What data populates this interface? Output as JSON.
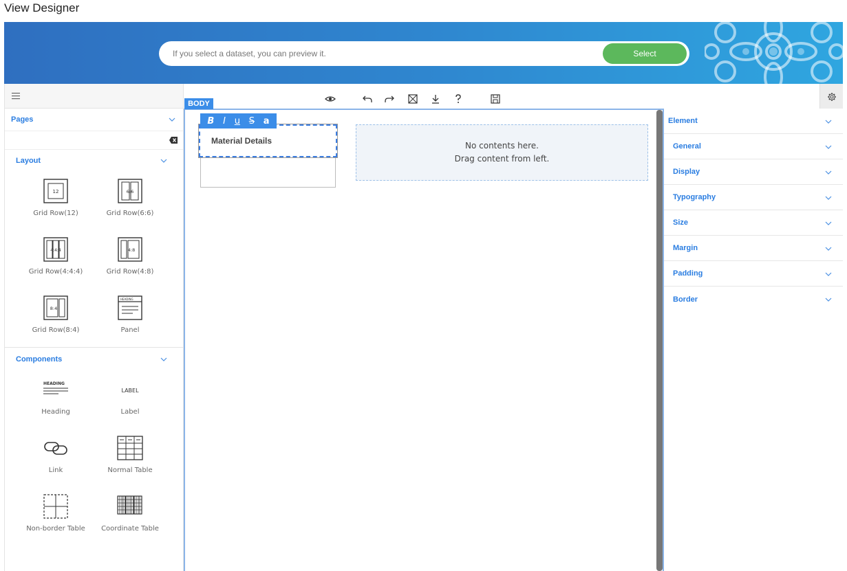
{
  "app": {
    "title": "View Designer"
  },
  "banner": {
    "search_placeholder": "If you select a dataset, you can preview it.",
    "select_label": "Select",
    "select_color": "#5cb85c"
  },
  "left_panel": {
    "pages_label": "Pages",
    "layout_label": "Layout",
    "layout_items": [
      {
        "label": "Grid Row(12)",
        "icon": "grid-row-12-icon"
      },
      {
        "label": "Grid Row(6:6)",
        "icon": "grid-row-6-6-icon"
      },
      {
        "label": "Grid Row(4:4:4)",
        "icon": "grid-row-4-4-4-icon"
      },
      {
        "label": "Grid Row(4:8)",
        "icon": "grid-row-4-8-icon"
      },
      {
        "label": "Grid Row(8:4)",
        "icon": "grid-row-8-4-icon"
      },
      {
        "label": "Panel",
        "icon": "panel-icon"
      }
    ],
    "components_label": "Components",
    "component_items": [
      {
        "label": "Heading",
        "icon": "heading-icon"
      },
      {
        "label": "Label",
        "icon": "label-icon"
      },
      {
        "label": "Link",
        "icon": "link-icon"
      },
      {
        "label": "Normal Table",
        "icon": "normal-table-icon"
      },
      {
        "label": "Non-border Table",
        "icon": "non-border-table-icon"
      },
      {
        "label": "Coordinate Table",
        "icon": "coordinate-table-icon"
      }
    ],
    "icon_texts": {
      "g12": "12",
      "g66": "6:6",
      "g444": "4:4:4",
      "g48": "4:8",
      "g84": "8:4",
      "panel": "HEADING",
      "heading": "HEADING",
      "label": "LABEL"
    }
  },
  "canvas": {
    "body_tag": "BODY",
    "format_buttons": [
      "B",
      "I",
      "u",
      "S",
      "a"
    ],
    "component_title": "Material Details",
    "empty_line1": "No contents here.",
    "empty_line2": "Drag content from left.",
    "accent": "#3b8de8"
  },
  "right_panel": {
    "properties": [
      "Element",
      "General",
      "Display",
      "Typography",
      "Size",
      "Margin",
      "Padding",
      "Border"
    ]
  }
}
